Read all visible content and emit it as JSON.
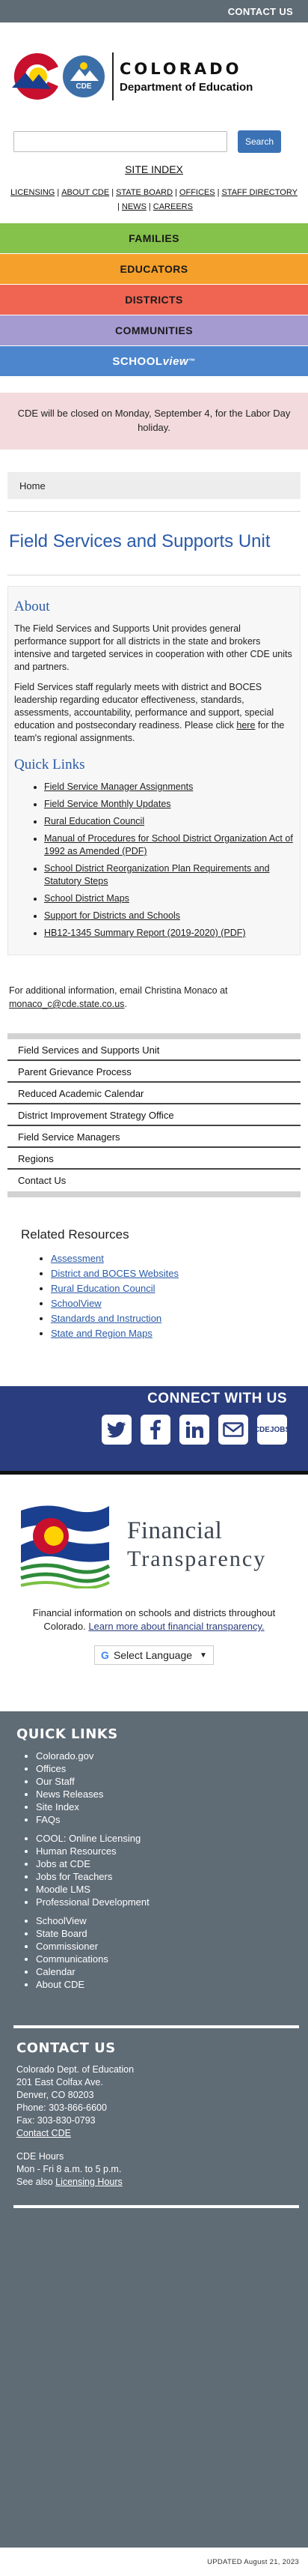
{
  "topbar": {
    "contact_us": "CONTACT US"
  },
  "logo": {
    "cde_badge": "CDE",
    "line1": "COLORADO",
    "line2": "Department of Education"
  },
  "search": {
    "placeholder": "",
    "button": "Search"
  },
  "site_index": "SITE INDEX",
  "util_links": [
    "LICENSING",
    "ABOUT CDE",
    "STATE BOARD",
    "OFFICES",
    "STAFF DIRECTORY",
    "NEWS",
    "CAREERS"
  ],
  "nav": [
    {
      "label": "FAMILIES",
      "color": "#84c24b"
    },
    {
      "label": "EDUCATORS",
      "color": "#f5a02a"
    },
    {
      "label": "DISTRICTS",
      "color": "#ef6552"
    },
    {
      "label": "COMMUNITIES",
      "color": "#a59bd1"
    }
  ],
  "schoolview": {
    "a": "SCHOOL",
    "b": "view",
    "c": "™",
    "color": "#4d86cd"
  },
  "alert": "CDE will be closed on Monday, September 4, for the Labor Day holiday.",
  "breadcrumb": "Home",
  "page_title": "Field Services and Supports Unit",
  "about": {
    "title": "About",
    "p1": "The Field Services and Supports Unit provides general performance support for all districts in the state and brokers intensive and targeted services in cooperation with other CDE units and partners.",
    "p2a": "Field Services staff regularly meets with district and BOCES leadership regarding educator effectiveness, standards, assessments, accountability, performance and support, special education and postsecondary readiness. Please click ",
    "p2link": "here",
    "p2b": " for the team's regional assignments."
  },
  "quick_links": {
    "title": "Quick Links",
    "items": [
      "Field Service Manager Assignments",
      "Field Service Monthly Updates",
      "Rural Education Council",
      "Manual of Procedures for School District Organization Act of 1992 as Amended (PDF)",
      "School District Reorganization Plan Requirements and Statutory Steps",
      "School District Maps",
      "Support for Districts and Schools",
      "HB12-1345 Summary Report (2019-2020) (PDF)"
    ]
  },
  "contact_info": {
    "text": "For additional information, email Christina Monaco at",
    "email": "monaco_c@cde.state.co.us",
    "end": "."
  },
  "side_menu": [
    "Field Services and Supports Unit",
    "Parent Grievance Process",
    "Reduced Academic Calendar",
    "District Improvement Strategy Office",
    "Field Service Managers",
    "Regions",
    "Contact Us"
  ],
  "related": {
    "title": "Related Resources",
    "items": [
      "Assessment",
      "District and BOCES Websites",
      "Rural Education Council",
      "SchoolView",
      "Standards and Instruction",
      "State and Region Maps"
    ]
  },
  "connect": {
    "title": "CONNECT WITH US",
    "icons": [
      "twitter-icon",
      "facebook-icon",
      "linkedin-icon",
      "email-icon"
    ],
    "jobs_line1": "CDE",
    "jobs_line2": "JOBS"
  },
  "financial": {
    "line1": "Financial",
    "line2": "Transparency",
    "desc": "Financial information on schools and districts throughout Colorado.",
    "link": "Learn more about financial transparency."
  },
  "language": {
    "label": "Select Language",
    "g": "G",
    "arrow": "▼"
  },
  "footer": {
    "quick_links_title": "QUICK LINKS",
    "group1": [
      "Colorado.gov",
      "Offices",
      "Our Staff",
      "News Releases",
      "Site Index",
      "FAQs"
    ],
    "group2": [
      "COOL: Online Licensing",
      "Human Resources",
      "Jobs at CDE",
      "Jobs for Teachers",
      "Moodle LMS",
      "Professional Development"
    ],
    "group3": [
      "SchoolView",
      "State Board",
      "Commissioner",
      "Communications",
      "Calendar",
      "About CDE"
    ],
    "contact_title": "CONTACT US",
    "org": "Colorado Dept. of Education",
    "addr1": "201 East Colfax Ave.",
    "addr2": "Denver, CO 80203",
    "phone": "Phone: 303-866-6600",
    "fax": "Fax: 303-830-0793",
    "contact_link": "Contact CDE",
    "hours_title": "CDE Hours",
    "hours": "Mon - Fri 8 a.m. to 5 p.m.",
    "see_also": "See also ",
    "licensing_hours": "Licensing Hours"
  },
  "updated": "UPDATED August 21, 2023"
}
